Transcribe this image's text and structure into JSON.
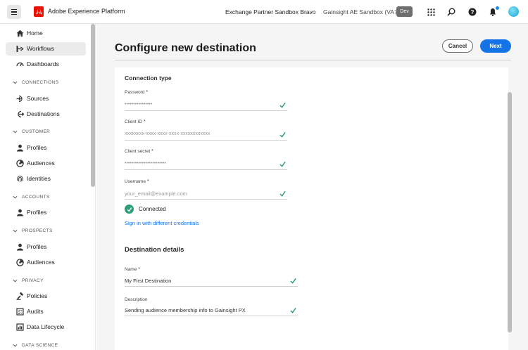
{
  "header": {
    "app_title": "Adobe Experience Platform",
    "org": "Exchange Partner Sandbox Bravo",
    "sandbox": "Gainsight AE Sandbox (VA7)",
    "env_badge": "Dev",
    "icons": [
      "menu-icon",
      "adobe-logo",
      "apps-grid-icon",
      "search-icon",
      "help-icon",
      "bell-icon",
      "avatar"
    ]
  },
  "sidebar": {
    "items": [
      {
        "label": "Home",
        "icon": "home-icon"
      },
      {
        "label": "Workflows",
        "icon": "workflows-icon",
        "active": true
      },
      {
        "label": "Dashboards",
        "icon": "dashboard-icon"
      }
    ],
    "sections": [
      {
        "title": "CONNECTIONS",
        "items": [
          {
            "label": "Sources",
            "icon": "sources-icon"
          },
          {
            "label": "Destinations",
            "icon": "destinations-icon"
          }
        ]
      },
      {
        "title": "CUSTOMER",
        "items": [
          {
            "label": "Profiles",
            "icon": "profile-icon"
          },
          {
            "label": "Audiences",
            "icon": "audiences-icon"
          },
          {
            "label": "Identities",
            "icon": "fingerprint-icon"
          }
        ]
      },
      {
        "title": "ACCOUNTS",
        "items": [
          {
            "label": "Profiles",
            "icon": "profile-icon"
          }
        ]
      },
      {
        "title": "PROSPECTS",
        "items": [
          {
            "label": "Profiles",
            "icon": "profile-icon"
          },
          {
            "label": "Audiences",
            "icon": "audiences-icon"
          }
        ]
      },
      {
        "title": "PRIVACY",
        "items": [
          {
            "label": "Policies",
            "icon": "policies-icon"
          },
          {
            "label": "Audits",
            "icon": "audits-icon"
          },
          {
            "label": "Data Lifecycle",
            "icon": "data-lifecycle-icon"
          }
        ]
      },
      {
        "title": "DATA SCIENCE",
        "items": []
      }
    ]
  },
  "main": {
    "title": "Configure new destination",
    "cancel_label": "Cancel",
    "next_label": "Next",
    "connection": {
      "title": "Connection type",
      "fields": [
        {
          "label": "Password",
          "value": "••••••••••••••••"
        },
        {
          "label": "Client ID",
          "value": "xxxxxxxx-xxxx-xxxx-xxxx-xxxxxxxxxxxx"
        },
        {
          "label": "Client secret",
          "value": "••••••••••••••••••••••••"
        },
        {
          "label": "Username",
          "value": "your_email@example.com"
        }
      ],
      "status": "Connected",
      "signin_link": "Sign in with different credentials"
    },
    "destination": {
      "title": "Destination details",
      "name_label": "Name",
      "name_value": "My First Destination",
      "description_label": "Description",
      "description_value": "Sending audience membership info to Gainsight PX"
    },
    "required_marker": "*",
    "colors": {
      "accent": "#1473e6",
      "success": "#2d9d78",
      "adobe_red": "#eb1000"
    }
  }
}
